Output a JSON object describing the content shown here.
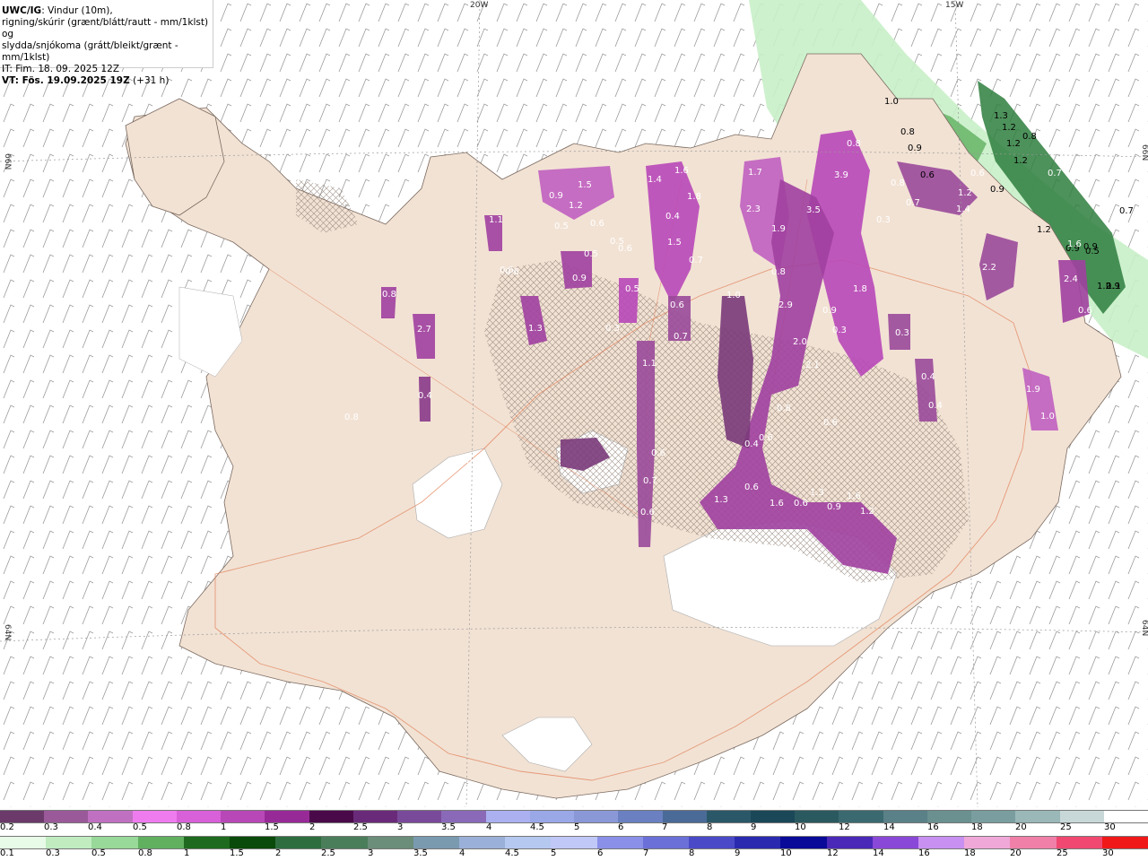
{
  "title": {
    "line1_bold": "UWC/IG",
    "line1_rest": ": Vindur (10m),",
    "line2": "rigning/skúrir (grænt/blátt/rautt - mm/1klst) og",
    "line3": "slydda/snjókoma (grátt/bleikt/grænt - mm/1klst)",
    "line4": "IT: Fim. 18. 09. 2025 12Z",
    "line5_bold": "VT: Fös. 19.09.2025 19Z",
    "line5_rest": " (+31 h)"
  },
  "axis_labels": {
    "top_lon_1": "20W",
    "top_lon_2": "15W",
    "left_lat_1": "66N",
    "left_lat_2": "64N",
    "right_lat_1": "66N",
    "right_lat_2": "64N"
  },
  "map_values": [
    {
      "t": "1.0",
      "c": "k",
      "lat": 0
    },
    {
      "t": "0.8",
      "c": "k"
    },
    {
      "t": "0.9",
      "c": "k"
    },
    {
      "t": "1.3",
      "c": "k"
    },
    {
      "t": "1.2",
      "c": "k"
    },
    {
      "t": "0.8",
      "c": "k"
    },
    {
      "t": "1.2",
      "c": "k"
    },
    {
      "t": "1.2",
      "c": "k"
    },
    {
      "t": "0.9",
      "c": "k"
    },
    {
      "t": "0.7",
      "c": "k"
    },
    {
      "t": "1.2",
      "c": "k"
    },
    {
      "t": "0.9",
      "c": "k"
    },
    {
      "t": "0.9",
      "c": "k"
    },
    {
      "t": "0.6",
      "c": "k"
    },
    {
      "t": "0.9",
      "c": "w"
    },
    {
      "t": "1.5",
      "c": "w"
    },
    {
      "t": "0.5",
      "c": "w"
    },
    {
      "t": "0.6",
      "c": "w"
    },
    {
      "t": "1.2",
      "c": "w"
    },
    {
      "t": "0.5",
      "c": "w"
    },
    {
      "t": "0.6",
      "c": "w"
    },
    {
      "t": "0.5",
      "c": "w"
    },
    {
      "t": "0.6",
      "c": "w"
    },
    {
      "t": "0.9",
      "c": "w"
    },
    {
      "t": "1.4",
      "c": "w"
    },
    {
      "t": "1.6",
      "c": "w"
    },
    {
      "t": "1.8",
      "c": "w"
    },
    {
      "t": "0.4",
      "c": "w"
    },
    {
      "t": "1.5",
      "c": "w"
    },
    {
      "t": "0.7",
      "c": "w"
    },
    {
      "t": "0.5",
      "c": "w"
    },
    {
      "t": "0.6",
      "c": "w"
    },
    {
      "t": "0.7",
      "c": "w"
    },
    {
      "t": "1.0",
      "c": "w"
    },
    {
      "t": "1.7",
      "c": "w"
    },
    {
      "t": "2.3",
      "c": "w"
    },
    {
      "t": "1.9",
      "c": "w"
    },
    {
      "t": "0.8",
      "c": "w"
    },
    {
      "t": "2.9",
      "c": "w"
    },
    {
      "t": "2.0",
      "c": "w"
    },
    {
      "t": "2.1",
      "c": "w"
    },
    {
      "t": "0.8",
      "c": "w"
    },
    {
      "t": "0.6",
      "c": "w"
    },
    {
      "t": "0.4",
      "c": "w"
    },
    {
      "t": "0.6",
      "c": "w"
    },
    {
      "t": "0.6",
      "c": "w"
    },
    {
      "t": "1.3",
      "c": "w"
    },
    {
      "t": "1.6",
      "c": "w"
    },
    {
      "t": "0.6",
      "c": "w"
    },
    {
      "t": "1.3",
      "c": "w"
    },
    {
      "t": "1.6",
      "c": "w"
    },
    {
      "t": "0.9",
      "c": "w"
    },
    {
      "t": "1.2",
      "c": "w"
    },
    {
      "t": "0.8",
      "c": "w"
    },
    {
      "t": "3.9",
      "c": "w"
    },
    {
      "t": "3.5",
      "c": "w"
    },
    {
      "t": "0.3",
      "c": "w"
    },
    {
      "t": "0.8",
      "c": "w"
    },
    {
      "t": "0.7",
      "c": "w"
    },
    {
      "t": "0.9",
      "c": "w"
    },
    {
      "t": "0.3",
      "c": "w"
    },
    {
      "t": "1.8",
      "c": "w"
    },
    {
      "t": "0.3",
      "c": "w"
    },
    {
      "t": "0.4",
      "c": "w"
    },
    {
      "t": "0.4",
      "c": "w"
    },
    {
      "t": "0.8",
      "c": "w"
    },
    {
      "t": "1.4",
      "c": "w"
    },
    {
      "t": "0.6",
      "c": "w"
    },
    {
      "t": "1.2",
      "c": "w"
    },
    {
      "t": "2.2",
      "c": "w"
    },
    {
      "t": "2.4",
      "c": "w"
    },
    {
      "t": "0.6",
      "c": "w"
    },
    {
      "t": "1.9",
      "c": "w"
    },
    {
      "t": "1.0",
      "c": "w"
    },
    {
      "t": "0.8",
      "c": "w"
    },
    {
      "t": "2.7",
      "c": "w"
    },
    {
      "t": "0.4",
      "c": "w"
    },
    {
      "t": "0.5",
      "c": "w"
    },
    {
      "t": "1.1",
      "c": "w"
    },
    {
      "t": "0.6",
      "c": "w"
    },
    {
      "t": "1.3",
      "c": "w"
    },
    {
      "t": "0.3",
      "c": "w"
    },
    {
      "t": "1.1",
      "c": "w"
    },
    {
      "t": "0.6",
      "c": "w"
    },
    {
      "t": "0.7",
      "c": "w"
    },
    {
      "t": "0.6",
      "c": "w"
    },
    {
      "t": "0.7",
      "c": "w"
    },
    {
      "t": "1.6",
      "c": "w"
    },
    {
      "t": "1.2",
      "c": "k"
    },
    {
      "t": "0.9",
      "c": "k"
    },
    {
      "t": "1.1",
      "c": "k"
    },
    {
      "t": "0.5",
      "c": "k"
    }
  ],
  "legend_snow": {
    "labels": [
      "0.2",
      "0.3",
      "0.4",
      "0.5",
      "0.8",
      "1",
      "1.5",
      "2",
      "2.5",
      "3",
      "3.5",
      "4",
      "4.5",
      "5",
      "6",
      "7",
      "8",
      "9",
      "10",
      "12",
      "14",
      "16",
      "18",
      "20",
      "25",
      "30"
    ],
    "colors": [
      "#6b3a6b",
      "#9a5a9a",
      "#c070c0",
      "#ef7cef",
      "#d860d8",
      "#b848b8",
      "#982a98",
      "#4a0a4a",
      "#6a2a7a",
      "#7a4a9a",
      "#8a6ab8",
      "#aab0f0",
      "#9aa8e8",
      "#8a98d8",
      "#6a80c0",
      "#4a6a98",
      "#2a5868",
      "#1a4858",
      "#2a5a60",
      "#3a6a70",
      "#5a8088",
      "#6a9090",
      "#7a9ea0",
      "#9ab8b8",
      "#c8d8d8",
      "#ffffff"
    ]
  },
  "legend_rain": {
    "labels": [
      "0.1",
      "0.3",
      "0.5",
      "0.8",
      "1",
      "1.5",
      "2",
      "2.5",
      "3",
      "3.5",
      "4",
      "4.5",
      "5",
      "6",
      "7",
      "8",
      "9",
      "10",
      "12",
      "14",
      "16",
      "18",
      "20",
      "25",
      "30"
    ],
    "colors": [
      "#e8fae8",
      "#c0ecc0",
      "#98d898",
      "#60b060",
      "#1e6a1e",
      "#0a4a0a",
      "#2e6e3e",
      "#4a7e5a",
      "#6a8e7a",
      "#7a9ab0",
      "#9ab0d8",
      "#b4c8f0",
      "#c0c8f8",
      "#8a90e8",
      "#6a70d8",
      "#4a4ac8",
      "#2a2ab0",
      "#0a0a98",
      "#4a28b8",
      "#8a48d8",
      "#c890f0",
      "#f0a8d8",
      "#f080a8",
      "#f04870",
      "#f01818"
    ]
  }
}
